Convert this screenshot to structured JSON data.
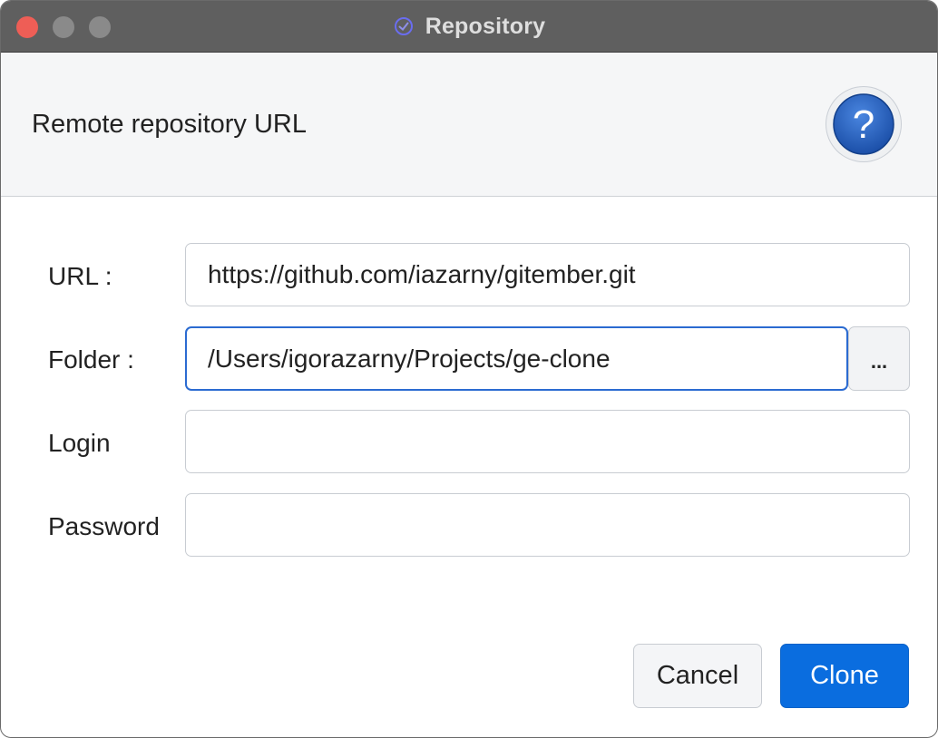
{
  "window": {
    "title": "Repository",
    "app_icon": "gitember-icon"
  },
  "header": {
    "title": "Remote repository URL",
    "help_icon": "question-mark-icon"
  },
  "form": {
    "url_label": "URL :",
    "url_value": "https://github.com/iazarny/gitember.git",
    "folder_label": "Folder :",
    "folder_value": "/Users/igorazarny/Projects/ge-clone",
    "browse_label": "...",
    "login_label": "Login",
    "login_value": "",
    "password_label": "Password",
    "password_value": ""
  },
  "buttons": {
    "cancel": "Cancel",
    "clone": "Clone"
  },
  "colors": {
    "accent": "#0a6ddf",
    "titlebar": "#5f5f5f",
    "close": "#ee5e56"
  }
}
